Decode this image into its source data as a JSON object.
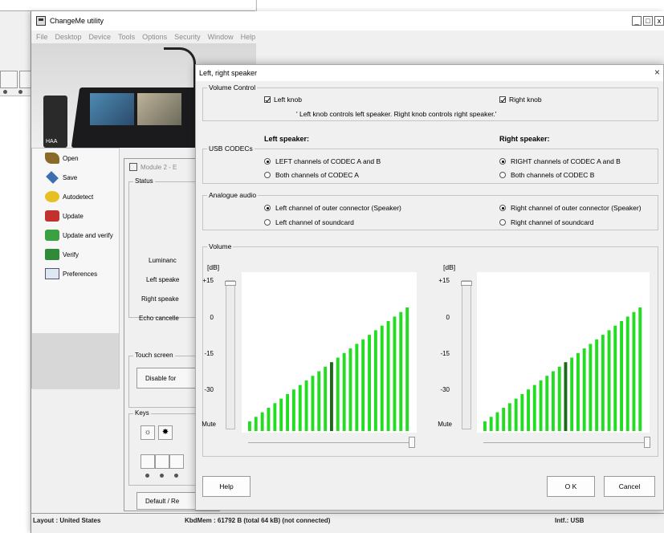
{
  "app": {
    "title": "ChangeMe utility",
    "menu": [
      "File",
      "Desktop",
      "Device",
      "Tools",
      "Options",
      "Security",
      "Window",
      "Help"
    ],
    "window_buttons": [
      "_",
      "□",
      "x"
    ]
  },
  "device": {
    "phone_label": "HAA"
  },
  "sidebar": {
    "items": [
      {
        "label": "Open",
        "icon": "open-folder-icon"
      },
      {
        "label": "Save",
        "icon": "save-icon"
      },
      {
        "label": "Autodetect",
        "icon": "autodetect-icon"
      },
      {
        "label": "Update",
        "icon": "update-icon"
      },
      {
        "label": "Update and verify",
        "icon": "update-verify-icon"
      },
      {
        "label": "Verify",
        "icon": "verify-icon"
      },
      {
        "label": "Preferences",
        "icon": "preferences-icon"
      }
    ]
  },
  "module": {
    "title": "Module 2 - E",
    "status_group": "Status",
    "labels": [
      "Luminanc",
      "Left speake",
      "Right speake",
      "Echo cancelle"
    ],
    "touch_group": "Touch screen",
    "touch_button": "Disable for",
    "keys_group": "Keys",
    "key_glyphs": [
      "☼",
      "✸"
    ],
    "default_button": "Default / Re"
  },
  "statusbar": {
    "layout": "Layout : United States",
    "memory": "KbdMem : 61792 B   (total 64 kB) (not connected)",
    "interface": "Intf.: USB"
  },
  "dialog": {
    "title": "Left, right speaker",
    "close": "×",
    "volume_control": {
      "legend": "Volume Control",
      "left_knob": {
        "label": "Left knob",
        "checked": true
      },
      "right_knob": {
        "label": "Right knob",
        "checked": true
      },
      "note": "' Left knob controls left speaker. Right knob controls right speaker.'"
    },
    "headers": {
      "left": "Left speaker:",
      "right": "Right speaker:"
    },
    "usb": {
      "legend": "USB CODECs",
      "left_options": [
        {
          "label": "LEFT channels of CODEC A and B",
          "selected": true
        },
        {
          "label": "Both channels of CODEC A",
          "selected": false
        }
      ],
      "right_options": [
        {
          "label": "RIGHT channels of CODEC A and B",
          "selected": true
        },
        {
          "label": "Both channels of CODEC B",
          "selected": false
        }
      ]
    },
    "analogue": {
      "legend": "Analogue audio",
      "left_options": [
        {
          "label": "Left channel of outer connector (Speaker)",
          "selected": true
        },
        {
          "label": "Left channel of soundcard",
          "selected": false
        }
      ],
      "right_options": [
        {
          "label": "Right channel of outer connector (Speaker)",
          "selected": true
        },
        {
          "label": "Right channel of soundcard",
          "selected": false
        }
      ]
    },
    "volume": {
      "legend": "Volume",
      "unit": "[dB]",
      "ticks": [
        "+15",
        "0",
        "-15",
        "-30",
        "Mute"
      ],
      "bar_count": 26,
      "active_bar_index": 13,
      "slider_value_fraction": 1.0,
      "colors": {
        "bar": "#22dd22",
        "active": "#1a6a1a"
      }
    },
    "buttons": {
      "help": "Help",
      "ok": "O K",
      "cancel": "Cancel"
    }
  }
}
